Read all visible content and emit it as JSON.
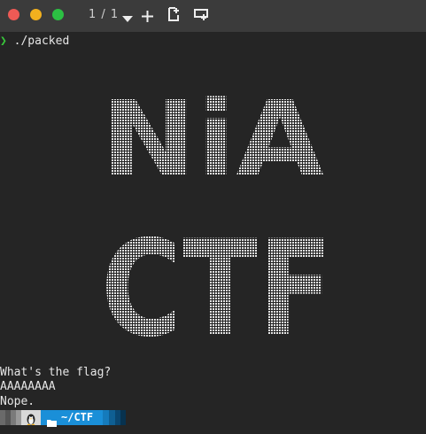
{
  "titlebar": {
    "tab_counter": "1 / 1",
    "buttons": {
      "close_color": "#ee5a55",
      "minimize_color": "#f2b01e",
      "maximize_color": "#2cc043"
    }
  },
  "terminal": {
    "prompt_glyph": "❯",
    "command": "./packed",
    "ascii_art": [
      "NiA",
      "CTF"
    ],
    "output_lines": [
      "What's the flag?",
      "AAAAAAAA",
      "Nope."
    ]
  },
  "statusbar": {
    "os_icon": "linux-penguin-icon",
    "folder_icon": "folder-icon",
    "path": "~/CTF",
    "accent_color": "#1a8fd8"
  }
}
